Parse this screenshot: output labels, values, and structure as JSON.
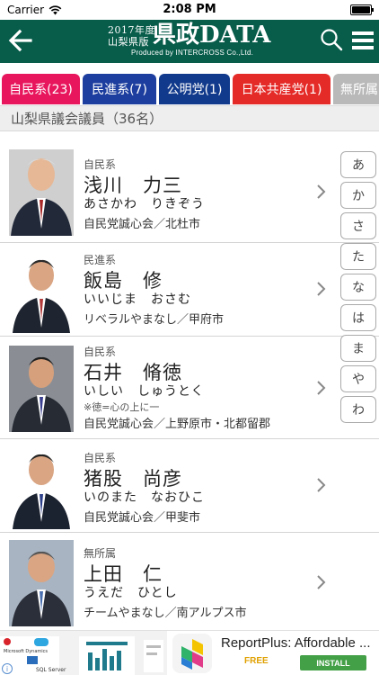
{
  "status_bar": {
    "carrier": "Carrier",
    "time": "2:08 PM"
  },
  "header": {
    "year_line": "2017年度",
    "pref_line": "山梨県版",
    "title_big": "県政DATA",
    "producer": "Produced by INTERCROSS Co.,Ltd."
  },
  "tabs": [
    {
      "label": "自民系(23)",
      "color": "#e8175d"
    },
    {
      "label": "民進系(7)",
      "color": "#1d3e9e"
    },
    {
      "label": "公明党(1)",
      "color": "#123a8c"
    },
    {
      "label": "日本共産党(1)",
      "color": "#e52b28"
    },
    {
      "label": "無所属",
      "color": "#b9b9b9"
    }
  ],
  "section": {
    "title": "山梨県議会議員（36名）"
  },
  "members": [
    {
      "party": "自民系",
      "name": "浅川　力三",
      "kana": "あさかわ　りきぞう",
      "note": "",
      "faction": "自民党誠心会／北杜市"
    },
    {
      "party": "民進系",
      "name": "飯島　修",
      "kana": "いいじま　おさむ",
      "note": "",
      "faction": "リベラルやまなし／甲府市"
    },
    {
      "party": "自民系",
      "name": "石井　脩徳",
      "kana": "いしい　しゅうとく",
      "note": "※徳=心の上に一",
      "faction": "自民党誠心会／上野原市・北都留郡"
    },
    {
      "party": "自民系",
      "name": "猪股　尚彦",
      "kana": "いのまた　なおひこ",
      "note": "",
      "faction": "自民党誠心会／甲斐市"
    },
    {
      "party": "無所属",
      "name": "上田　仁",
      "kana": "うえだ　ひとし",
      "note": "",
      "faction": "チームやまなし／南アルプス市"
    }
  ],
  "kana_index": [
    "あ",
    "か",
    "さ",
    "た",
    "な",
    "は",
    "ま",
    "や",
    "わ"
  ],
  "ad": {
    "title": "ReportPlus: Affordable ...",
    "free_label": "FREE",
    "install_label": "INSTALL",
    "thumb_labels": [
      "Microsoft Dynamics",
      "SQL Server"
    ]
  },
  "colors": {
    "nav": "#075c4a",
    "row_divider": "#d4d4d4"
  }
}
